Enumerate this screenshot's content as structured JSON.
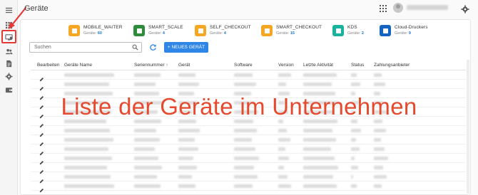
{
  "header": {
    "title": "Geräte"
  },
  "sidebar": {
    "items": [
      {
        "name": "menu-icon"
      },
      {
        "name": "apps-icon"
      },
      {
        "name": "devices-icon",
        "active": true
      },
      {
        "name": "users-icon"
      },
      {
        "name": "document-icon"
      },
      {
        "name": "settings-icon"
      },
      {
        "name": "wallet-icon"
      }
    ]
  },
  "device_types": [
    {
      "name": "MOBILE_WAITER",
      "label": "Geräte:",
      "count": "60",
      "color": "#f5a623"
    },
    {
      "name": "SMART_SCALE",
      "label": "Geräte:",
      "count": "4",
      "color": "#2e8b3a"
    },
    {
      "name": "SELF_CHECKOUT",
      "label": "Geräte:",
      "count": "4",
      "color": "#f5a623"
    },
    {
      "name": "SMART_CHECKOUT",
      "label": "Geräte:",
      "count": "15",
      "color": "#f5a623"
    },
    {
      "name": "KDS",
      "label": "Geräte:",
      "count": "2",
      "color": "#19b29c"
    },
    {
      "name": "Cloud-Druckers",
      "label": "Geräte:",
      "count": "9",
      "color": "#1565c0"
    }
  ],
  "search": {
    "placeholder": "Suchen"
  },
  "add_button": {
    "label": "+ NEUES GERÄT"
  },
  "table": {
    "columns": [
      "Bearbeiten",
      "Geräte Name",
      "Seriennummer ↑",
      "Gerät",
      "Software",
      "Version",
      "Letzte Aktivität",
      "Status",
      "Zahlungsanbieter"
    ],
    "row_count": 13
  },
  "overlay_text": "Liste der Geräte im Unternehmen",
  "colors": {
    "accent": "#2f86e6",
    "annotation": "#e53935"
  }
}
